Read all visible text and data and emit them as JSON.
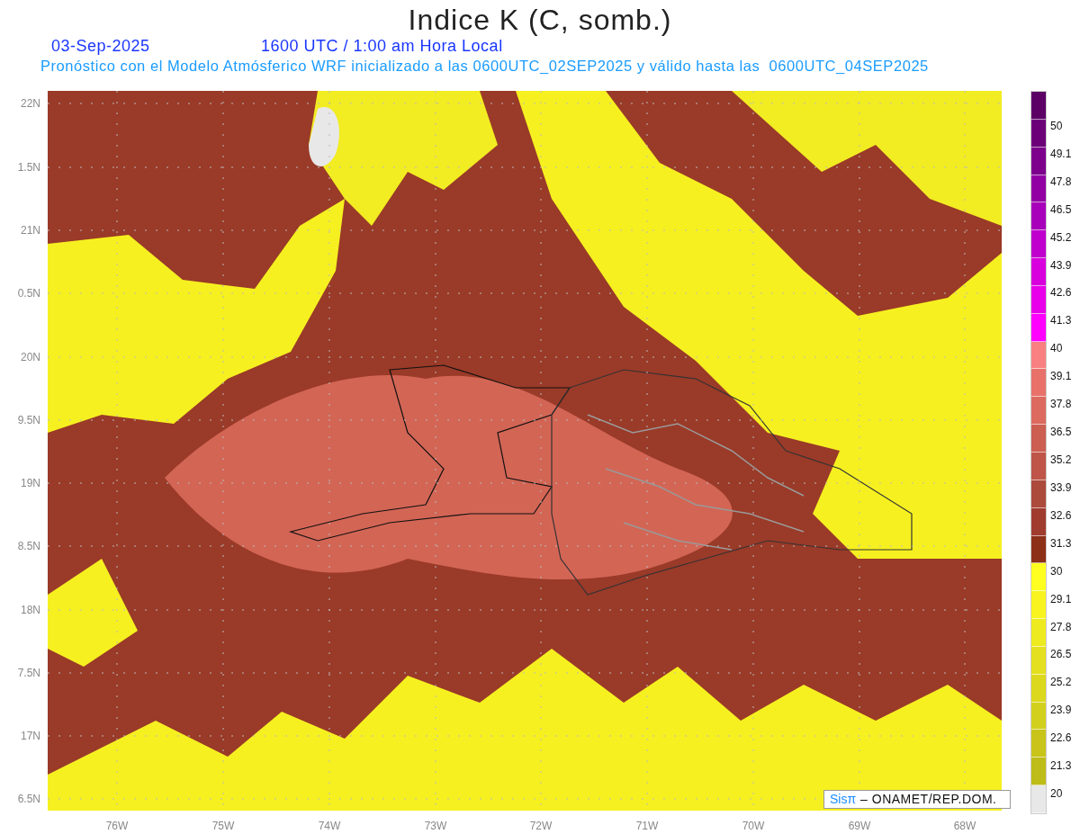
{
  "title": "Indice K (C, somb.)",
  "date": "03-Sep-2025",
  "time": "1600 UTC / 1:00 am Hora Local",
  "subtitle": "Pronóstico con el Modelo Atmósferico WRF inicializado a las 0600UTC_02SEP2025 y válido hasta las  0600UTC_04SEP2025",
  "y_axis_labels": [
    "22N",
    "1.5N",
    "21N",
    "0.5N",
    "20N",
    "9.5N",
    "19N",
    "8.5N",
    "18N",
    "7.5N",
    "17N",
    "6.5N"
  ],
  "x_axis_labels": [
    "76W",
    "75W",
    "74W",
    "73W",
    "72W",
    "71W",
    "70W",
    "69W",
    "68W"
  ],
  "colorbar": {
    "bins": [
      {
        "color": "#5c0066"
      },
      {
        "color": "#6b0078"
      },
      {
        "color": "#7c008c"
      },
      {
        "color": "#9200a4"
      },
      {
        "color": "#a800ba"
      },
      {
        "color": "#c000cc"
      },
      {
        "color": "#d800dc"
      },
      {
        "color": "#e800ea"
      },
      {
        "color": "#ff00ff"
      },
      {
        "color": "#f88080"
      },
      {
        "color": "#e8726a"
      },
      {
        "color": "#dc6a5e"
      },
      {
        "color": "#cc5e52"
      },
      {
        "color": "#be5548"
      },
      {
        "color": "#ac4a3c"
      },
      {
        "color": "#a03c2e"
      },
      {
        "color": "#8c3018"
      },
      {
        "color": "#ffff20"
      },
      {
        "color": "#f8f420"
      },
      {
        "color": "#eeea20"
      },
      {
        "color": "#e4e020"
      },
      {
        "color": "#dcd81e"
      },
      {
        "color": "#d2d01c"
      },
      {
        "color": "#c8c41a"
      },
      {
        "color": "#bebc18"
      },
      {
        "color": "#e8e8e8"
      }
    ],
    "labels": [
      "50",
      "49.1",
      "47.8",
      "46.5",
      "45.2",
      "43.9",
      "42.6",
      "41.3",
      "40",
      "39.1",
      "37.8",
      "36.5",
      "35.2",
      "33.9",
      "32.6",
      "31.3",
      "30",
      "29.1",
      "27.8",
      "26.5",
      "25.2",
      "23.9",
      "22.6",
      "21.3",
      "20"
    ]
  },
  "credit": {
    "logo": "Sisπ",
    "text": "– ONAMET/REP.DOM."
  }
}
